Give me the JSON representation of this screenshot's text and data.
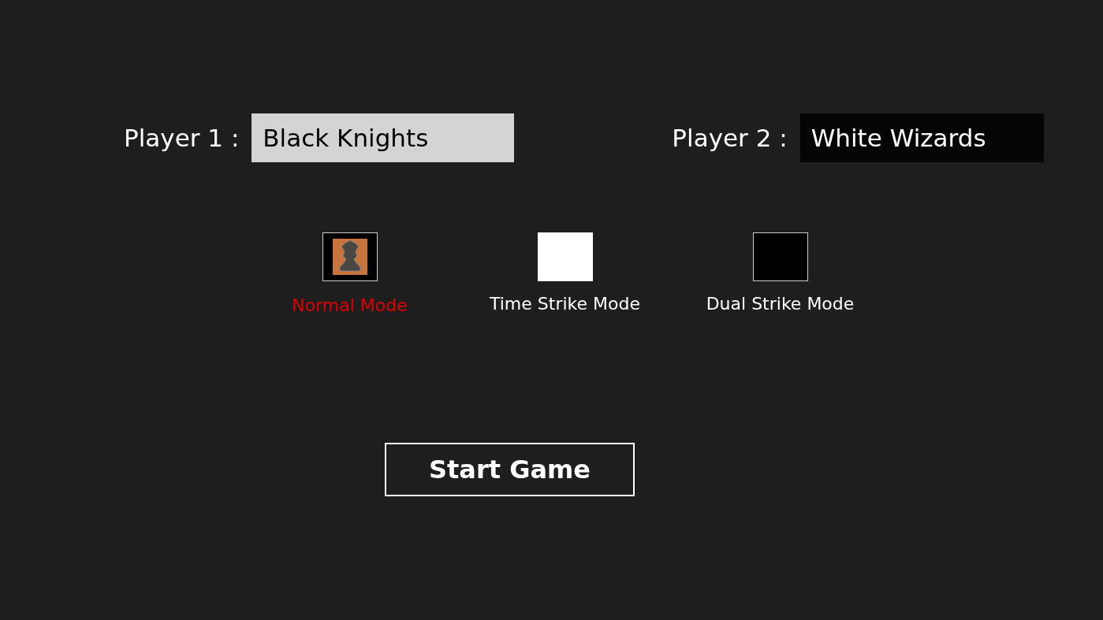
{
  "players": [
    {
      "label": "Player 1 :",
      "value": "Black Knights",
      "focused": true
    },
    {
      "label": "Player 2 :",
      "value": "White Wizards",
      "focused": false
    }
  ],
  "modes": [
    {
      "label": "Normal Mode",
      "kind": "piece",
      "selected": true
    },
    {
      "label": "Time Strike Mode",
      "kind": "white",
      "selected": false
    },
    {
      "label": "Dual Strike Mode",
      "kind": "black",
      "selected": false
    }
  ],
  "start_button": "Start Game"
}
